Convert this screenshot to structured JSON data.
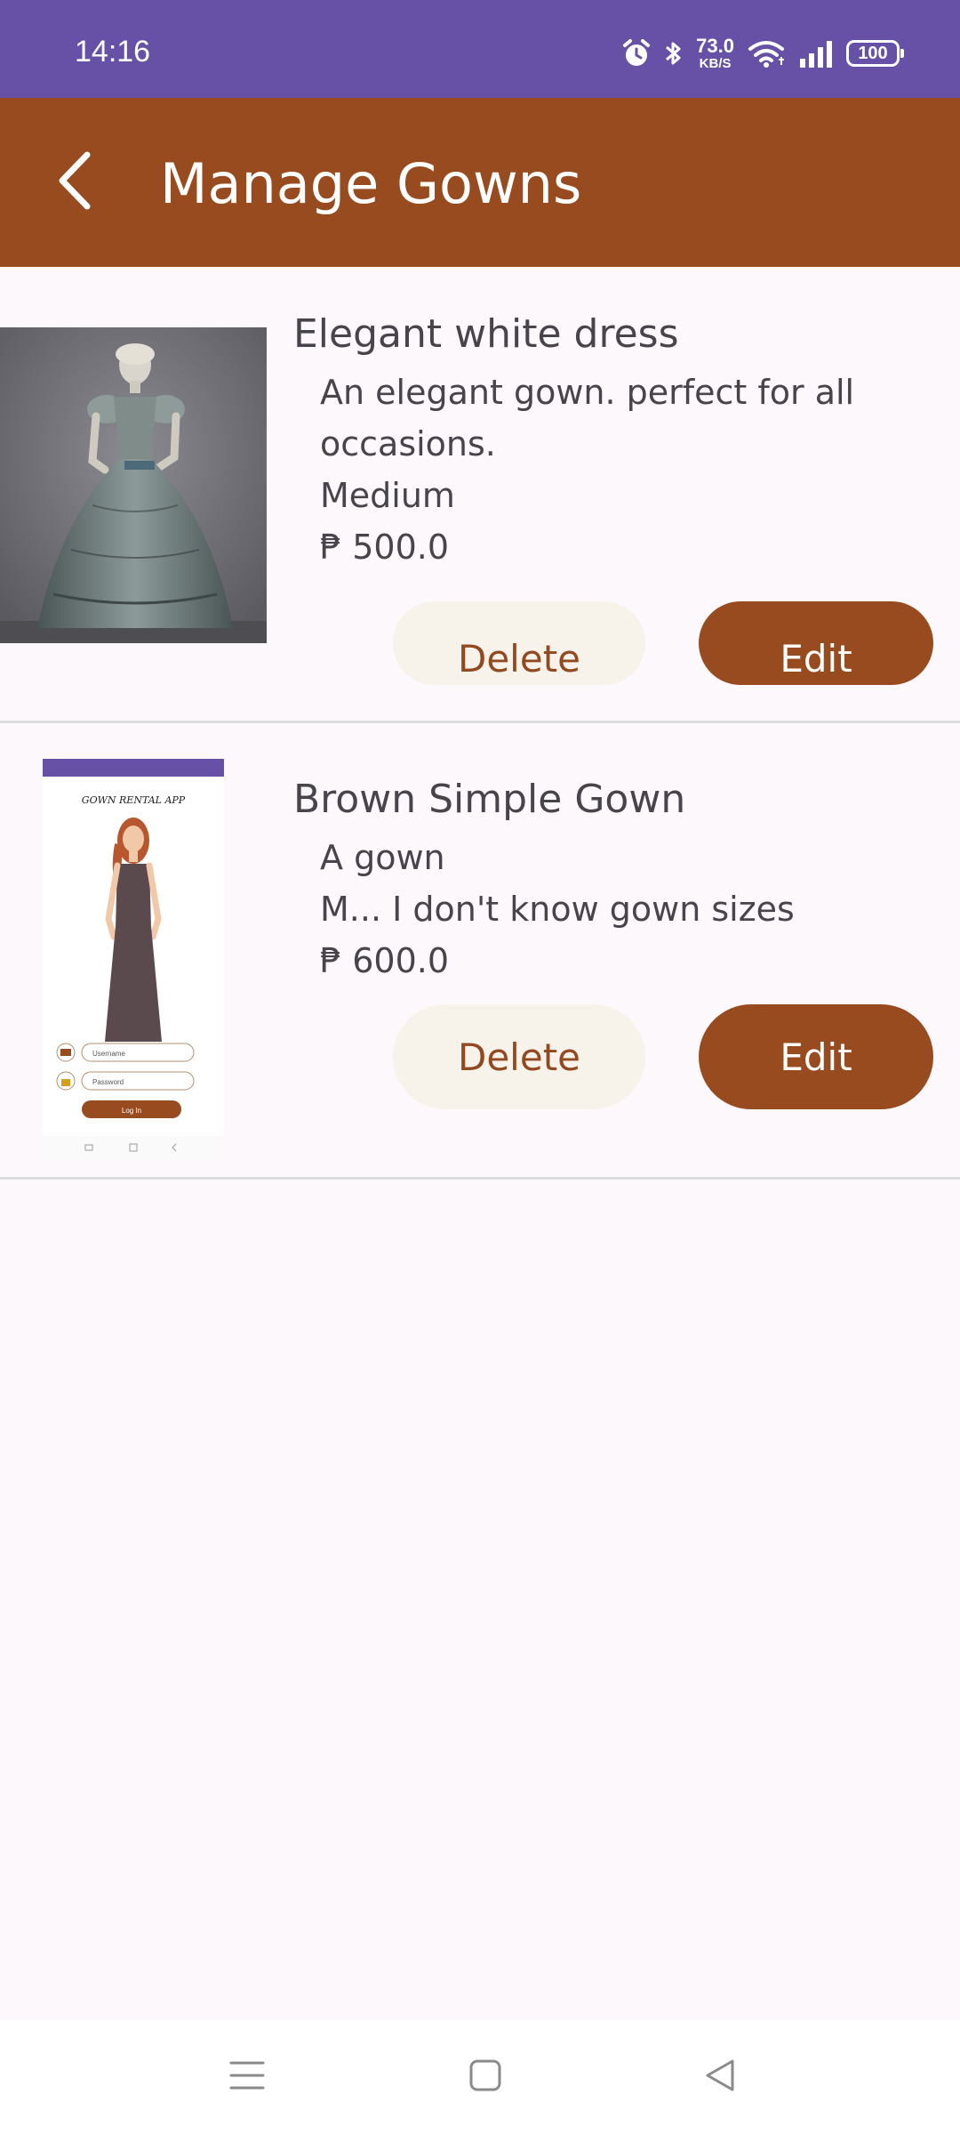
{
  "status_bar": {
    "time": "14:16",
    "net_speed_value": "73.0",
    "net_speed_unit": "KB/S",
    "battery": "100",
    "icons": [
      "alarm-icon",
      "bluetooth-icon",
      "wifi-icon",
      "signal-icon",
      "battery-icon"
    ]
  },
  "toolbar": {
    "title": "Manage Gowns",
    "back_icon": "chevron-left-icon"
  },
  "gowns": [
    {
      "name": "Elegant white dress",
      "description": "An elegant gown. perfect for all occasions.",
      "size": "Medium",
      "price": "₱ 500.0",
      "delete_label": "Delete",
      "edit_label": "Edit"
    },
    {
      "name": "Brown Simple Gown",
      "description": "A gown",
      "size": "M... I don't know gown sizes",
      "price": "₱ 600.0",
      "delete_label": "Delete",
      "edit_label": "Edit",
      "thumbnail": {
        "app_title": "GOWN RENTAL APP",
        "username_placeholder": "Username",
        "password_placeholder": "Password",
        "login_label": "Log In"
      }
    }
  ],
  "colors": {
    "status_bar": "#6651a6",
    "toolbar": "#974b1e",
    "delete_bg": "#f7f2ea",
    "edit_bg": "#974b1e",
    "background": "#fdf8fc"
  },
  "nav_bar": {
    "icons": [
      "menu-icon",
      "home-square-icon",
      "back-triangle-icon"
    ]
  }
}
